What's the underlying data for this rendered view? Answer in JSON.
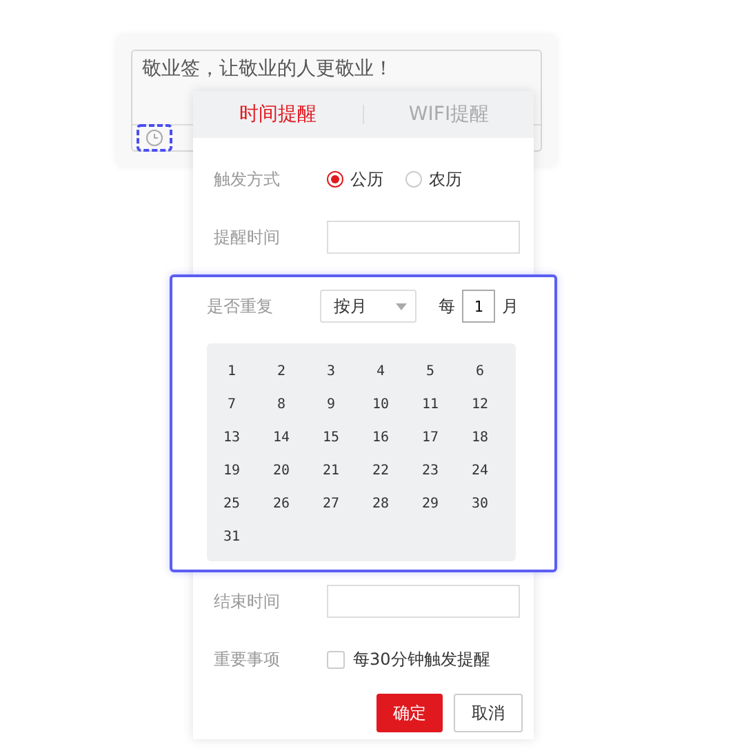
{
  "note": {
    "text": "敬业签，让敬业的人更敬业！"
  },
  "tabs": [
    {
      "label": "时间提醒",
      "selected": true
    },
    {
      "label": "WIFI提醒",
      "selected": false
    }
  ],
  "trigger": {
    "label": "触发方式",
    "options": [
      {
        "label": "公历",
        "selected": true
      },
      {
        "label": "农历",
        "selected": false
      }
    ]
  },
  "remind_time": {
    "label": "提醒时间"
  },
  "repeat": {
    "label": "是否重复",
    "select_value": "按月",
    "every_prefix": "每",
    "every_value": "1",
    "every_unit": "月",
    "days": [
      "1",
      "2",
      "3",
      "4",
      "5",
      "6",
      "7",
      "8",
      "9",
      "10",
      "11",
      "12",
      "13",
      "14",
      "15",
      "16",
      "17",
      "18",
      "19",
      "20",
      "21",
      "22",
      "23",
      "24",
      "25",
      "26",
      "27",
      "28",
      "29",
      "30",
      "31"
    ]
  },
  "end_time": {
    "label": "结束时间"
  },
  "important": {
    "label": "重要事项",
    "checkbox_label": "每30分钟触发提醒",
    "checked": false
  },
  "buttons": [
    {
      "label": "确定",
      "kind": "primary"
    },
    {
      "label": "取消",
      "kind": "secondary"
    }
  ]
}
